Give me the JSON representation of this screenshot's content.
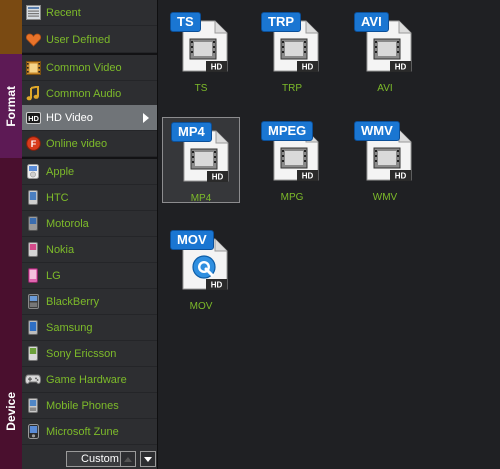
{
  "tabs": {
    "format": "Format",
    "device": "Device"
  },
  "list": {
    "items": [
      {
        "label": "Recent",
        "icon": "recent-icon"
      },
      {
        "label": "User Defined",
        "icon": "heart-icon"
      },
      {
        "label": "Common Video",
        "icon": "film-icon"
      },
      {
        "label": "Common Audio",
        "icon": "music-note-icon"
      },
      {
        "label": "HD Video",
        "icon": "hd-icon"
      },
      {
        "label": "Online video",
        "icon": "online-video-icon"
      },
      {
        "label": "Apple",
        "icon": "ipod-icon"
      },
      {
        "label": "HTC",
        "icon": "phone-icon"
      },
      {
        "label": "Motorola",
        "icon": "phone-icon"
      },
      {
        "label": "Nokia",
        "icon": "phone-icon"
      },
      {
        "label": "LG",
        "icon": "phone-icon"
      },
      {
        "label": "BlackBerry",
        "icon": "phone-icon"
      },
      {
        "label": "Samsung",
        "icon": "phone-icon"
      },
      {
        "label": "Sony Ericsson",
        "icon": "phone-icon"
      },
      {
        "label": "Game Hardware",
        "icon": "gamepad-icon"
      },
      {
        "label": "Mobile Phones",
        "icon": "phone-icon"
      },
      {
        "label": "Microsoft Zune",
        "icon": "zune-icon"
      }
    ],
    "selected": "HD Video"
  },
  "footer": {
    "custom_label": "Custom"
  },
  "formats": [
    {
      "badge": "TS",
      "caption": "TS",
      "icon": "film-icon"
    },
    {
      "badge": "TRP",
      "caption": "TRP",
      "icon": "film-icon"
    },
    {
      "badge": "AVI",
      "caption": "AVI",
      "icon": "film-icon"
    },
    {
      "badge": "MP4",
      "caption": "MP4",
      "icon": "film-icon"
    },
    {
      "badge": "MPEG",
      "caption": "MPG",
      "icon": "film-icon"
    },
    {
      "badge": "WMV",
      "caption": "WMV",
      "icon": "film-icon"
    },
    {
      "badge": "MOV",
      "caption": "MOV",
      "icon": "quicktime-icon"
    }
  ],
  "hd_tag": "HD",
  "selected_format": "MP4",
  "colors": {
    "accent_text": "#7dbb2a",
    "badge_blue": "#1a76d2",
    "selected_row": "#707478",
    "tab_recent": "#7a4a12",
    "tab_format": "#5d1a55",
    "tab_device": "#4a0f2e"
  }
}
